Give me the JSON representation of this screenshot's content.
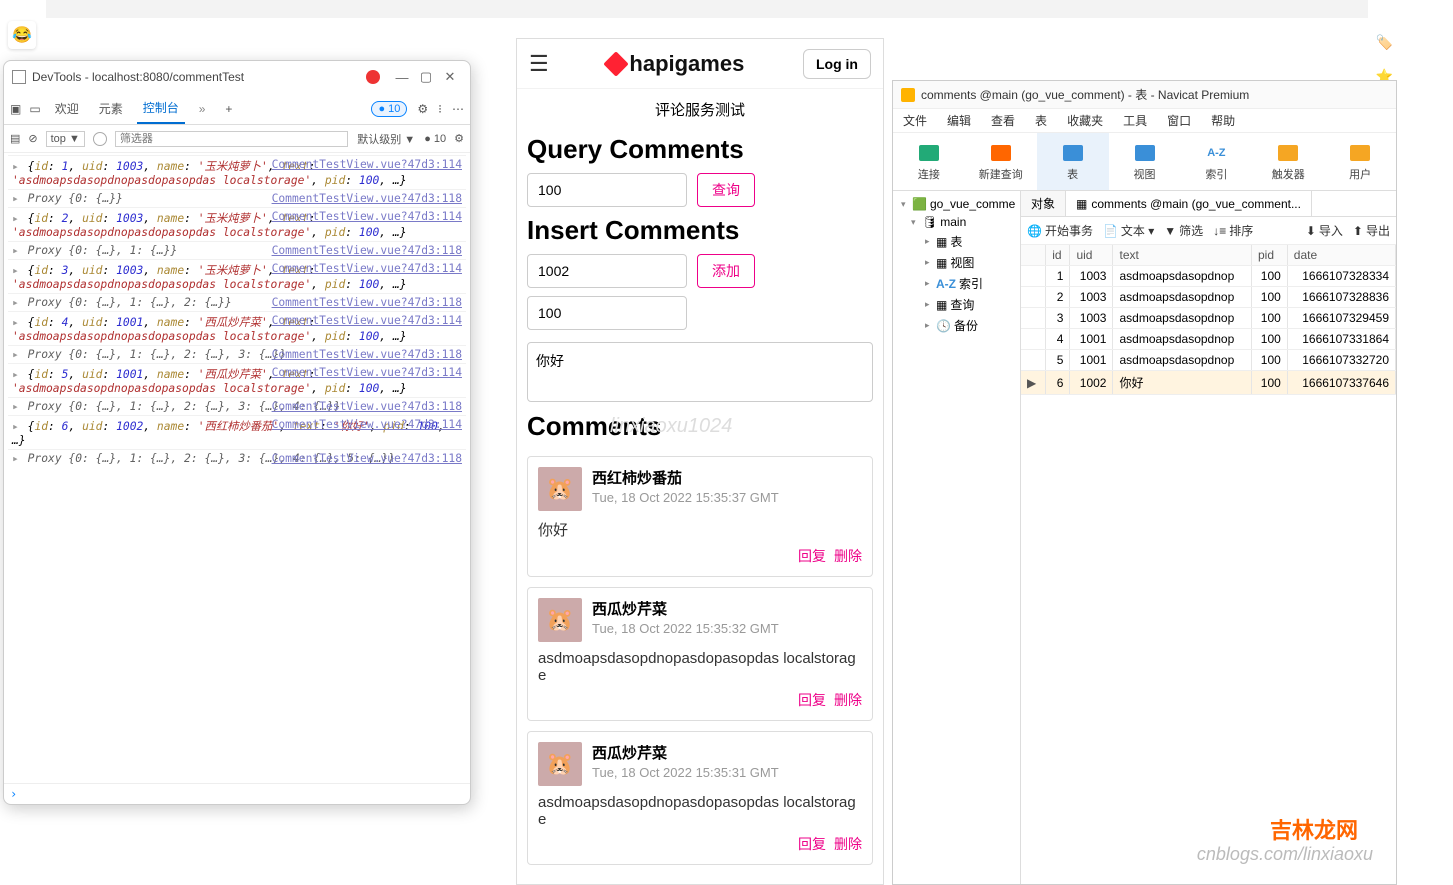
{
  "devtools": {
    "title": "DevTools - localhost:8080/commentTest",
    "tabs": {
      "a": "欢迎",
      "b": "元素",
      "c": "控制台",
      "more": "»",
      "plus": "+"
    },
    "badge": "● 10",
    "filter": {
      "top": "top ▼",
      "placeholder": "筛选器",
      "level": "默认级别 ▼",
      "badge": "● 10"
    },
    "src114": "CommentTestView.vue?47d3:114",
    "src118": "CommentTestView.vue?47d3:118",
    "logs": [
      {
        "src": "114",
        "text": "{id: 1, uid: 1003, name: '玉米炖萝卜', text: 'asdmoapsdasopdnopasdopasopdas localstorage', pid: 100, …}"
      },
      {
        "src": "118",
        "text": "Proxy {0: {…}}"
      },
      {
        "src": "114",
        "text": "{id: 2, uid: 1003, name: '玉米炖萝卜', text: 'asdmoapsdasopdnopasdopasopdas localstorage', pid: 100, …}"
      },
      {
        "src": "118",
        "text": "Proxy {0: {…}, 1: {…}}"
      },
      {
        "src": "114",
        "text": "{id: 3, uid: 1003, name: '玉米炖萝卜', text: 'asdmoapsdasopdnopasdopasopdas localstorage', pid: 100, …}"
      },
      {
        "src": "118",
        "text": "Proxy {0: {…}, 1: {…}, 2: {…}}"
      },
      {
        "src": "114",
        "text": "{id: 4, uid: 1001, name: '西瓜炒芹菜', text: 'asdmoapsdasopdnopasdopasopdas localstorage', pid: 100, …}"
      },
      {
        "src": "118",
        "text": "Proxy {0: {…}, 1: {…}, 2: {…}, 3: {…}}"
      },
      {
        "src": "114",
        "text": "{id: 5, uid: 1001, name: '西瓜炒芹菜', text: 'asdmoapsdasopdnopasdopasopdas localstorage', pid: 100, …}"
      },
      {
        "src": "118",
        "text": "Proxy {0: {…}, 1: {…}, 2: {…}, 3: {…}, 4: {…}}"
      },
      {
        "src": "114",
        "text": "{id: 6, uid: 1002, name: '西红柿炒番茄', text: '你好', pid: 100, …}"
      },
      {
        "src": "118",
        "text": "Proxy {0: {…}, 1: {…}, 2: {…}, 3: {…}, 4: {…}, 5: {…}}"
      }
    ]
  },
  "mobile": {
    "login": "Log in",
    "logo": "hapigames",
    "title": "评论服务测试",
    "query_h": "Query Comments",
    "query_val": "100",
    "query_btn": "查询",
    "insert_h": "Insert Comments",
    "insert_uid": "1002",
    "insert_btn": "添加",
    "insert_pid": "100",
    "insert_text": "你好",
    "comments_h": "Comments",
    "reply": "回复",
    "delete": "删除",
    "comments": [
      {
        "name": "西红柿炒番茄",
        "time": "Tue, 18 Oct 2022 15:35:37 GMT",
        "text": "你好"
      },
      {
        "name": "西瓜炒芹菜",
        "time": "Tue, 18 Oct 2022 15:35:32 GMT",
        "text": "asdmoapsdasopdnopasdopasopdas localstorage"
      },
      {
        "name": "西瓜炒芹菜",
        "time": "Tue, 18 Oct 2022 15:35:31 GMT",
        "text": "asdmoapsdasopdnopasdopasopdas localstorage"
      }
    ]
  },
  "navicat": {
    "title": "comments @main (go_vue_comment) - 表 - Navicat Premium",
    "menu": [
      "文件",
      "编辑",
      "查看",
      "表",
      "收藏夹",
      "工具",
      "窗口",
      "帮助"
    ],
    "tools": [
      {
        "label": "连接",
        "color": "#2a7"
      },
      {
        "label": "新建查询",
        "color": "#f60"
      },
      {
        "label": "表",
        "color": "#3a8fd8",
        "active": true
      },
      {
        "label": "视图",
        "color": "#3a8fd8"
      },
      {
        "label": "索引",
        "color": "#3a8fd8",
        "text": "A-Z"
      },
      {
        "label": "触发器",
        "color": "#f5a623"
      },
      {
        "label": "用户",
        "color": "#f5a623"
      }
    ],
    "tree": {
      "root": "go_vue_comme",
      "db": "main",
      "items": [
        "表",
        "视图",
        "索引",
        "查询",
        "备份"
      ],
      "index_label": "A-Z"
    },
    "tabs": {
      "a": "对象",
      "b": "comments @main (go_vue_comment..."
    },
    "gridbar": {
      "begin": "开始事务",
      "text": "文本 ▾",
      "filter": "筛选",
      "sort": "排序",
      "import": "导入",
      "export": "导出"
    },
    "cols": [
      "id",
      "uid",
      "text",
      "pid",
      "date"
    ],
    "rows": [
      {
        "id": "1",
        "uid": "1003",
        "text": "asdmoapsdasopdnop",
        "pid": "100",
        "date": "1666107328334"
      },
      {
        "id": "2",
        "uid": "1003",
        "text": "asdmoapsdasopdnop",
        "pid": "100",
        "date": "1666107328836"
      },
      {
        "id": "3",
        "uid": "1003",
        "text": "asdmoapsdasopdnop",
        "pid": "100",
        "date": "1666107329459"
      },
      {
        "id": "4",
        "uid": "1001",
        "text": "asdmoapsdasopdnop",
        "pid": "100",
        "date": "1666107331864"
      },
      {
        "id": "5",
        "uid": "1001",
        "text": "asdmoapsdasopdnop",
        "pid": "100",
        "date": "1666107332720"
      },
      {
        "id": "6",
        "uid": "1002",
        "text": "你好",
        "pid": "100",
        "date": "1666107337646"
      }
    ]
  },
  "watermark": "cnblogs.com/linxiaoxu",
  "brand": "吉林龙网"
}
